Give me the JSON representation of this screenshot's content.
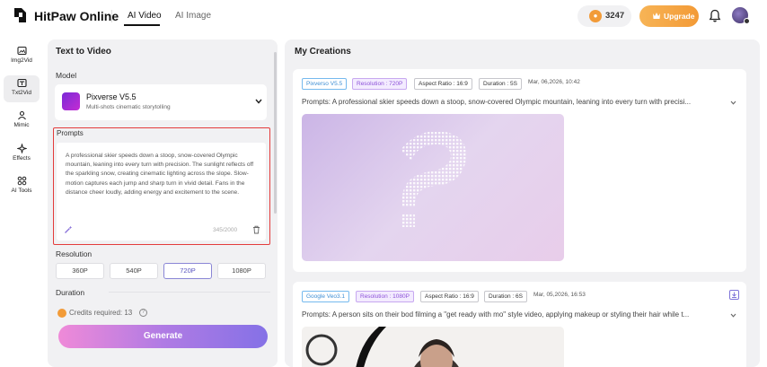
{
  "header": {
    "brand": "HitPaw Online",
    "tabs": [
      {
        "label": "AI Video",
        "active": true
      },
      {
        "label": "AI Image",
        "active": false
      }
    ],
    "credits": "3247",
    "upgrade_label": "Upgrade",
    "icons": {
      "coin": "coin-icon",
      "upgrade": "crown-icon",
      "bell": "bell-icon",
      "avatar": "avatar"
    }
  },
  "rail": {
    "items": [
      {
        "label": "Img2Vid",
        "icon": "image-to-video-icon",
        "active": false
      },
      {
        "label": "Txt2Vid",
        "icon": "text-to-video-icon",
        "active": true
      },
      {
        "label": "Mimic",
        "icon": "mimic-icon",
        "active": false
      },
      {
        "label": "Effects",
        "icon": "effects-icon",
        "active": false
      },
      {
        "label": "AI Tools",
        "icon": "ai-tools-icon",
        "active": false
      }
    ]
  },
  "left": {
    "title": "Text to Video",
    "model_label": "Model",
    "model_name": "Pixverse V5.5",
    "model_desc": "Multi-shots cinematic storytolling",
    "prompts_label": "Prompts",
    "prompt_text": "A professional skier speeds down a stoop, snow-covered Olympic mountain, leaning into every turn with precision. The sunlight reflects off the sparkling snow, creating cinematic lighting across the slope. Slow-motion captures each jump and sharp turn in vivid detail. Fans in the distance cheer loudly, adding energy and excitement to the scene.",
    "char_count": "345/2000",
    "resolution_label": "Resolution",
    "resolutions": [
      "360P",
      "540P",
      "720P",
      "1080P"
    ],
    "resolution_selected": "720P",
    "duration_label": "Duration",
    "credits_required": "Credits required: 13",
    "help_mark": "?",
    "generate_label": "Generate"
  },
  "creations": {
    "title": "My Creations",
    "items": [
      {
        "model_tag": "Pixverso V5.5",
        "resolution_tag": "Resolution : 720P",
        "aspect_tag": "Aspect Ratio : 16:9",
        "duration_tag": "Duration : 5S",
        "date": "Mar, 06,2026, 10:42",
        "prompt": "Prompts: A professional skier speeds down a stoop, snow-covered Olympic mountain, leaning into every turn with precisi..."
      },
      {
        "model_tag": "Google Veo3.1",
        "resolution_tag": "Resolution : 1080P",
        "aspect_tag": "Aspect Ratio : 16:9",
        "duration_tag": "Duration : 6S",
        "date": "Mar, 05,2026, 16:53",
        "prompt": "Prompts: A person sits on their bod filming a \"get ready with mo\" style video, applying makeup or styling their hair while t..."
      }
    ]
  },
  "colors": {
    "accent_purple": "#5a55c0",
    "upgrade_orange": "#f39a36",
    "generate_gradient_start": "#ef8ad8",
    "generate_gradient_end": "#8571e6",
    "highlight_red": "#e43c3c"
  }
}
